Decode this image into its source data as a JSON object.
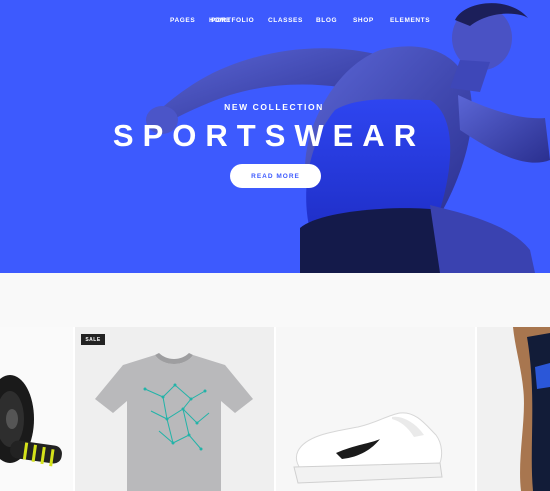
{
  "nav": {
    "items": [
      "HOME",
      "PAGES",
      "PORTFOLIO",
      "CLASSES",
      "BLOG",
      "SHOP",
      "ELEMENTS"
    ]
  },
  "hero": {
    "subtitle": "NEW COLLECTION",
    "title": "SPORTSWEAR",
    "button_label": "READ MORE",
    "background_color": "#3d5afe"
  },
  "products": {
    "badge": "SALE",
    "items": [
      {
        "image": "ab-roller-wheel"
      },
      {
        "image": "grey-graphic-t-shirt"
      },
      {
        "image": "white-nike-sneaker"
      },
      {
        "image": "dark-sports-top-model"
      }
    ]
  }
}
